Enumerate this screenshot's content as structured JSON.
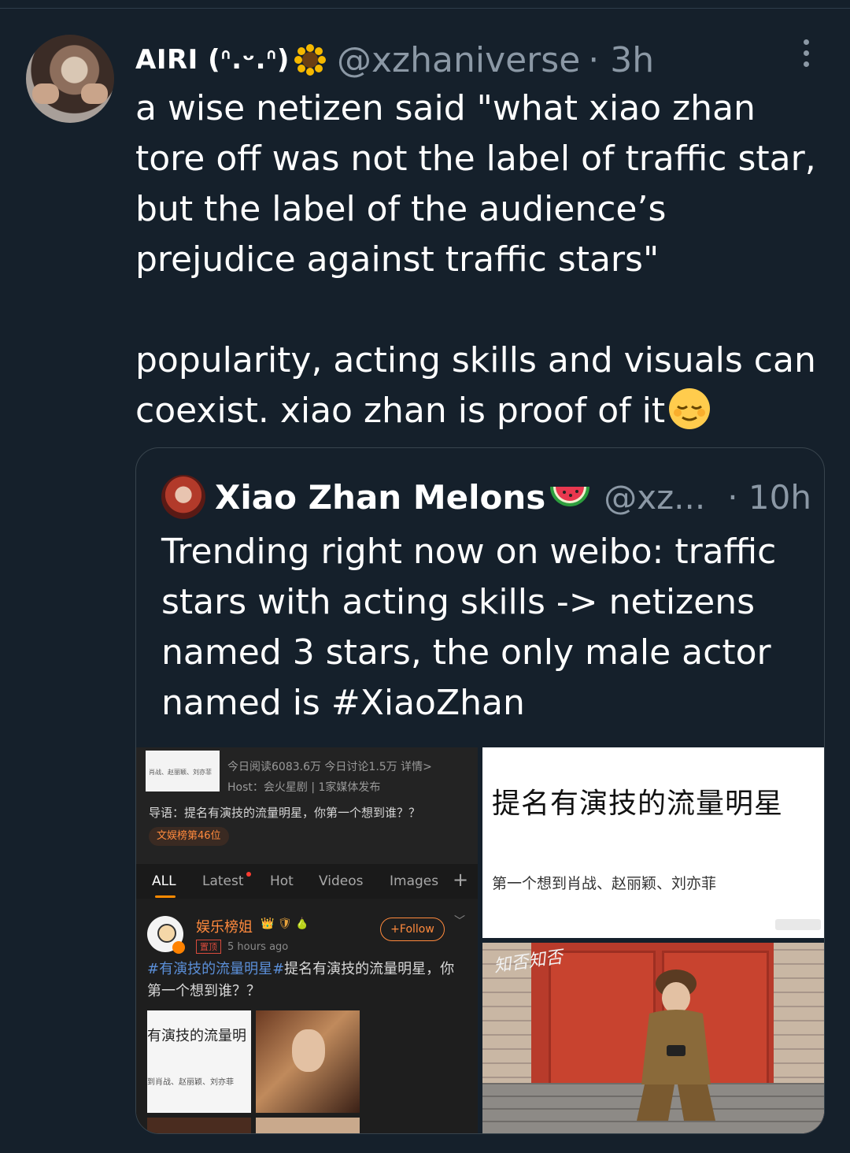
{
  "tweet": {
    "author_name": "AIRI (ᐢ.ᵕ.ᐢ)",
    "handle": "@xzhaniverse",
    "time": "· 3h",
    "text": "a wise netizen said \"what xiao zhan tore off was not the label of traffic star, but the label of the audience’s prejudice against traffic stars\"\n\npopularity, acting skills and visuals can coexist. xiao zhan is proof of it",
    "icons": [
      "avatar-photo",
      "sunflower-emoji",
      "more-options-icon",
      "relieved-face-emoji"
    ]
  },
  "quoted": {
    "author_name": "Xiao Zhan Melons",
    "handle": "@xz...",
    "time": "· 10h",
    "text": "Trending right now on weibo: traffic stars with acting skills -> netizens named 3 stars, the only male actor named is #XiaoZhan",
    "icons": [
      "watermelon-emoji"
    ],
    "media": {
      "weibo": {
        "thumb_text": "肖战、赵丽颖、刘亦菲",
        "stats": "今日阅读6083.6万 今日讨论1.5万 详情>",
        "host": "Host：会火星剧 | 1家媒体发布",
        "guide": "导语：提名有演技的流量明星，你第一个想到谁？？",
        "rank": "文娱榜第46位",
        "tabs": [
          "ALL",
          "Latest",
          "Hot",
          "Videos",
          "Images"
        ],
        "plus": "+",
        "post_user": "娱乐榜姐",
        "badges": "👑 🛡 🍐",
        "follow_label": "+Follow",
        "chevron": "﹀",
        "pinned": "置顶",
        "post_time": "5 hours ago",
        "post_hashtag": "#有演技的流量明星#",
        "post_text": "提名有演技的流量明星，你第一个想到谁？？",
        "pic_title": "有演技的流量明",
        "pic_sub": "到肖战、赵丽颖、刘亦菲"
      },
      "card": {
        "title": "提名有演技的流量明星",
        "subtitle": "第一个想到肖战、赵丽颖、刘亦菲"
      },
      "photo": {
        "script": "知否知否"
      }
    }
  }
}
